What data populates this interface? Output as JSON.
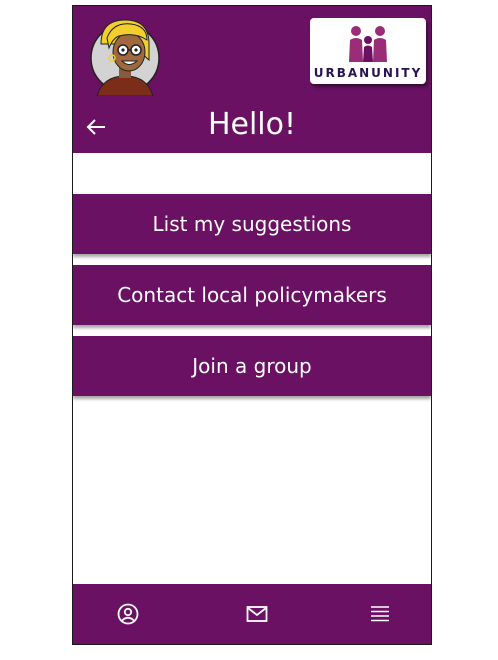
{
  "header": {
    "title": "Hello!",
    "logo_text": "URBANUNITY",
    "back_icon": "arrow-left-icon",
    "avatar_icon": "cartoon-avatar"
  },
  "menu": {
    "items": [
      {
        "label": "List my suggestions"
      },
      {
        "label": "Contact local policymakers"
      },
      {
        "label": "Join a group"
      }
    ]
  },
  "footer": {
    "icons": [
      "user-circle-icon",
      "mail-icon",
      "menu-lines-icon"
    ]
  },
  "colors": {
    "primary": "#6a1164",
    "logo_text": "#2a1450",
    "background": "#ffffff"
  }
}
